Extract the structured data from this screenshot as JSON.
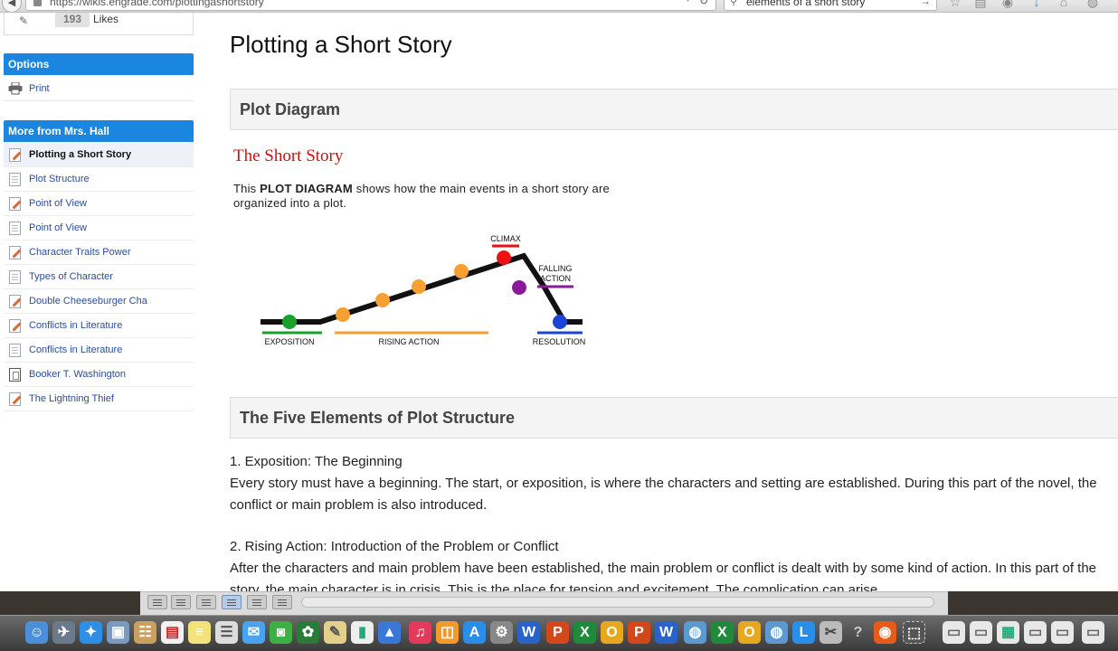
{
  "browser": {
    "url": "https://wikis.engrade.com/plottingashortstory",
    "search_query": "elements of a short story"
  },
  "sidebar": {
    "likes_count": "193",
    "likes_label": "Likes",
    "options_header": "Options",
    "print_label": "Print",
    "more_header": "More from Mrs. Hall",
    "more_items": [
      {
        "label": "Plotting a Short Story",
        "icon": "pencil-doc-icon",
        "active": true
      },
      {
        "label": "Plot Structure",
        "icon": "page-doc-icon"
      },
      {
        "label": "Point of View",
        "icon": "pencil-doc-icon"
      },
      {
        "label": "Point of View",
        "icon": "page-doc-icon"
      },
      {
        "label": "Character Traits Power",
        "icon": "pencil-doc-icon"
      },
      {
        "label": "Types of Character",
        "icon": "page-doc-icon"
      },
      {
        "label": "Double Cheeseburger Cha",
        "icon": "pencil-doc-icon"
      },
      {
        "label": "Conflicts in Literature",
        "icon": "pencil-doc-icon"
      },
      {
        "label": "Conflicts in Literature",
        "icon": "page-doc-icon"
      },
      {
        "label": "Booker T. Washington",
        "icon": "book-icon"
      },
      {
        "label": "The Lightning Thief",
        "icon": "pencil-doc-icon"
      }
    ]
  },
  "main": {
    "page_title": "Plotting a Short Story",
    "section1_title": "Plot Diagram",
    "story_heading": "The Short Story",
    "desc_pre": "This ",
    "desc_bold": "PLOT DIAGRAM",
    "desc_post": " shows how the main events in a short story are organized into a plot.",
    "diagram": {
      "climax": "CLIMAX",
      "falling_action_1": "FALLING",
      "falling_action_2": "ACTION",
      "exposition": "EXPOSITION",
      "rising_action": "RISING ACTION",
      "resolution": "RESOLUTION"
    },
    "section2_title": "The Five Elements of Plot Structure",
    "elements": [
      {
        "title": "1. Exposition: The Beginning",
        "text": "Every story must have a beginning. The start, or exposition, is where the characters and setting are established. During this part of the novel, the conflict or main problem is also introduced."
      },
      {
        "title": "2. Rising Action: Introduction of the Problem or Conflict",
        "text": "After the characters and main problem have been established, the main problem or conflict is dealt with by some kind of action. In this part of the story, the main character is in crisis. This is the place for tension and excitement. The complication can arise"
      }
    ]
  },
  "colors": {
    "header_blue": "#1a86e0",
    "link_blue": "#2a4d9a",
    "story_red": "#cc1111"
  }
}
